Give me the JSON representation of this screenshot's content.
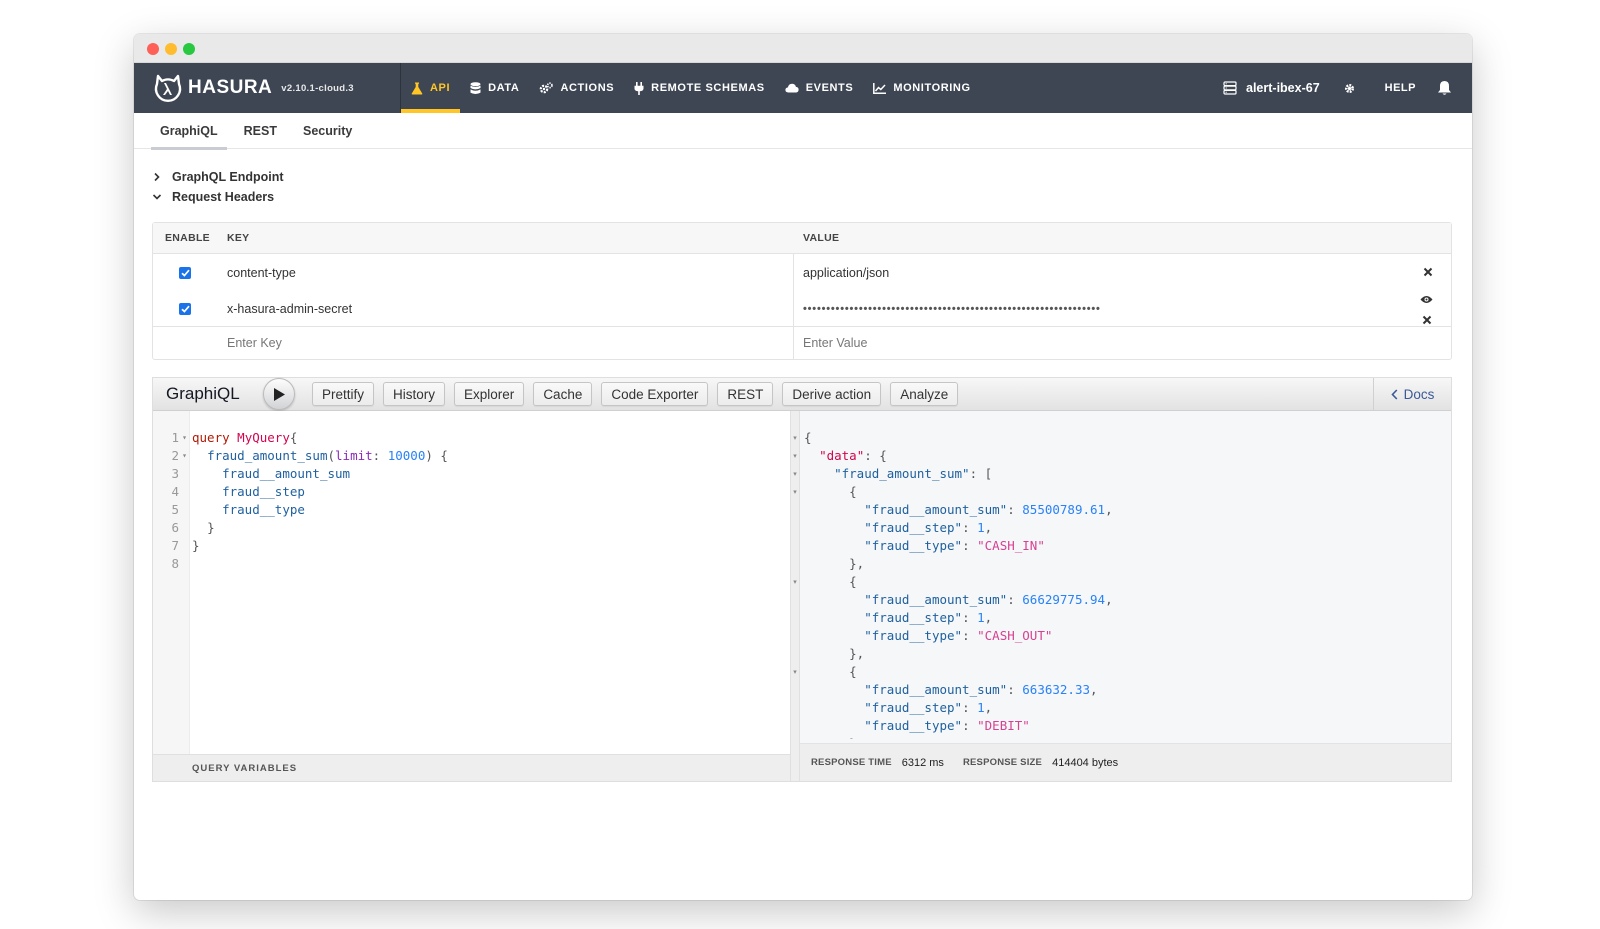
{
  "window": {
    "traffic_lights": [
      "close",
      "minimize",
      "zoom"
    ]
  },
  "navbar": {
    "brand": "HASURA",
    "version": "v2.10.1-cloud.3",
    "items": [
      {
        "label": "API",
        "icon": "flask-icon",
        "active": true
      },
      {
        "label": "DATA",
        "icon": "database-icon"
      },
      {
        "label": "ACTIONS",
        "icon": "cogs-icon"
      },
      {
        "label": "REMOTE SCHEMAS",
        "icon": "plug-icon"
      },
      {
        "label": "EVENTS",
        "icon": "cloud-icon"
      },
      {
        "label": "MONITORING",
        "icon": "chart-icon"
      }
    ],
    "project": "alert-ibex-67",
    "help": "HELP",
    "accent": "#ffc626",
    "background": "#3e4654"
  },
  "subtabs": [
    {
      "label": "GraphiQL",
      "active": true
    },
    {
      "label": "REST"
    },
    {
      "label": "Security"
    }
  ],
  "collapsibles": [
    {
      "label": "GraphQL Endpoint",
      "expanded": false
    },
    {
      "label": "Request Headers",
      "expanded": true
    }
  ],
  "headers_table": {
    "columns": {
      "enable": "ENABLE",
      "key": "KEY",
      "value": "VALUE"
    },
    "rows": [
      {
        "enabled": true,
        "key": "content-type",
        "value": "application/json"
      },
      {
        "enabled": true,
        "key": "x-hasura-admin-secret",
        "value": "••••••••••••••••••••••••••••••••••••••••••••••••••••••••••••••••"
      }
    ],
    "new_row": {
      "key_placeholder": "Enter Key",
      "value_placeholder": "Enter Value"
    }
  },
  "graphiql": {
    "title": "GraphiQL",
    "toolbar": [
      "Prettify",
      "History",
      "Explorer",
      "Cache",
      "Code Exporter",
      "REST",
      "Derive action",
      "Analyze"
    ],
    "docs": "Docs",
    "query_variables": "QUERY VARIABLES",
    "query_lines": [
      "query MyQuery{",
      "  fraud_amount_sum(limit: 10000) {",
      "    fraud__amount_sum",
      "    fraud__step",
      "    fraud__type",
      "  }",
      "}",
      ""
    ],
    "result_lines": [
      "{",
      "  \"data\": {",
      "    \"fraud_amount_sum\": [",
      "      {",
      "        \"fraud__amount_sum\": 85500789.61,",
      "        \"fraud__step\": 1,",
      "        \"fraud__type\": \"CASH_IN\"",
      "      },",
      "      {",
      "        \"fraud__amount_sum\": 66629775.94,",
      "        \"fraud__step\": 1,",
      "        \"fraud__type\": \"CASH_OUT\"",
      "      },",
      "      {",
      "        \"fraud__amount_sum\": 663632.33,",
      "        \"fraud__step\": 1,",
      "        \"fraud__type\": \"DEBIT\"",
      "      }"
    ],
    "response": {
      "time_label": "RESPONSE TIME",
      "time_value": "6312 ms",
      "size_label": "RESPONSE SIZE",
      "size_value": "414404 bytes"
    }
  }
}
